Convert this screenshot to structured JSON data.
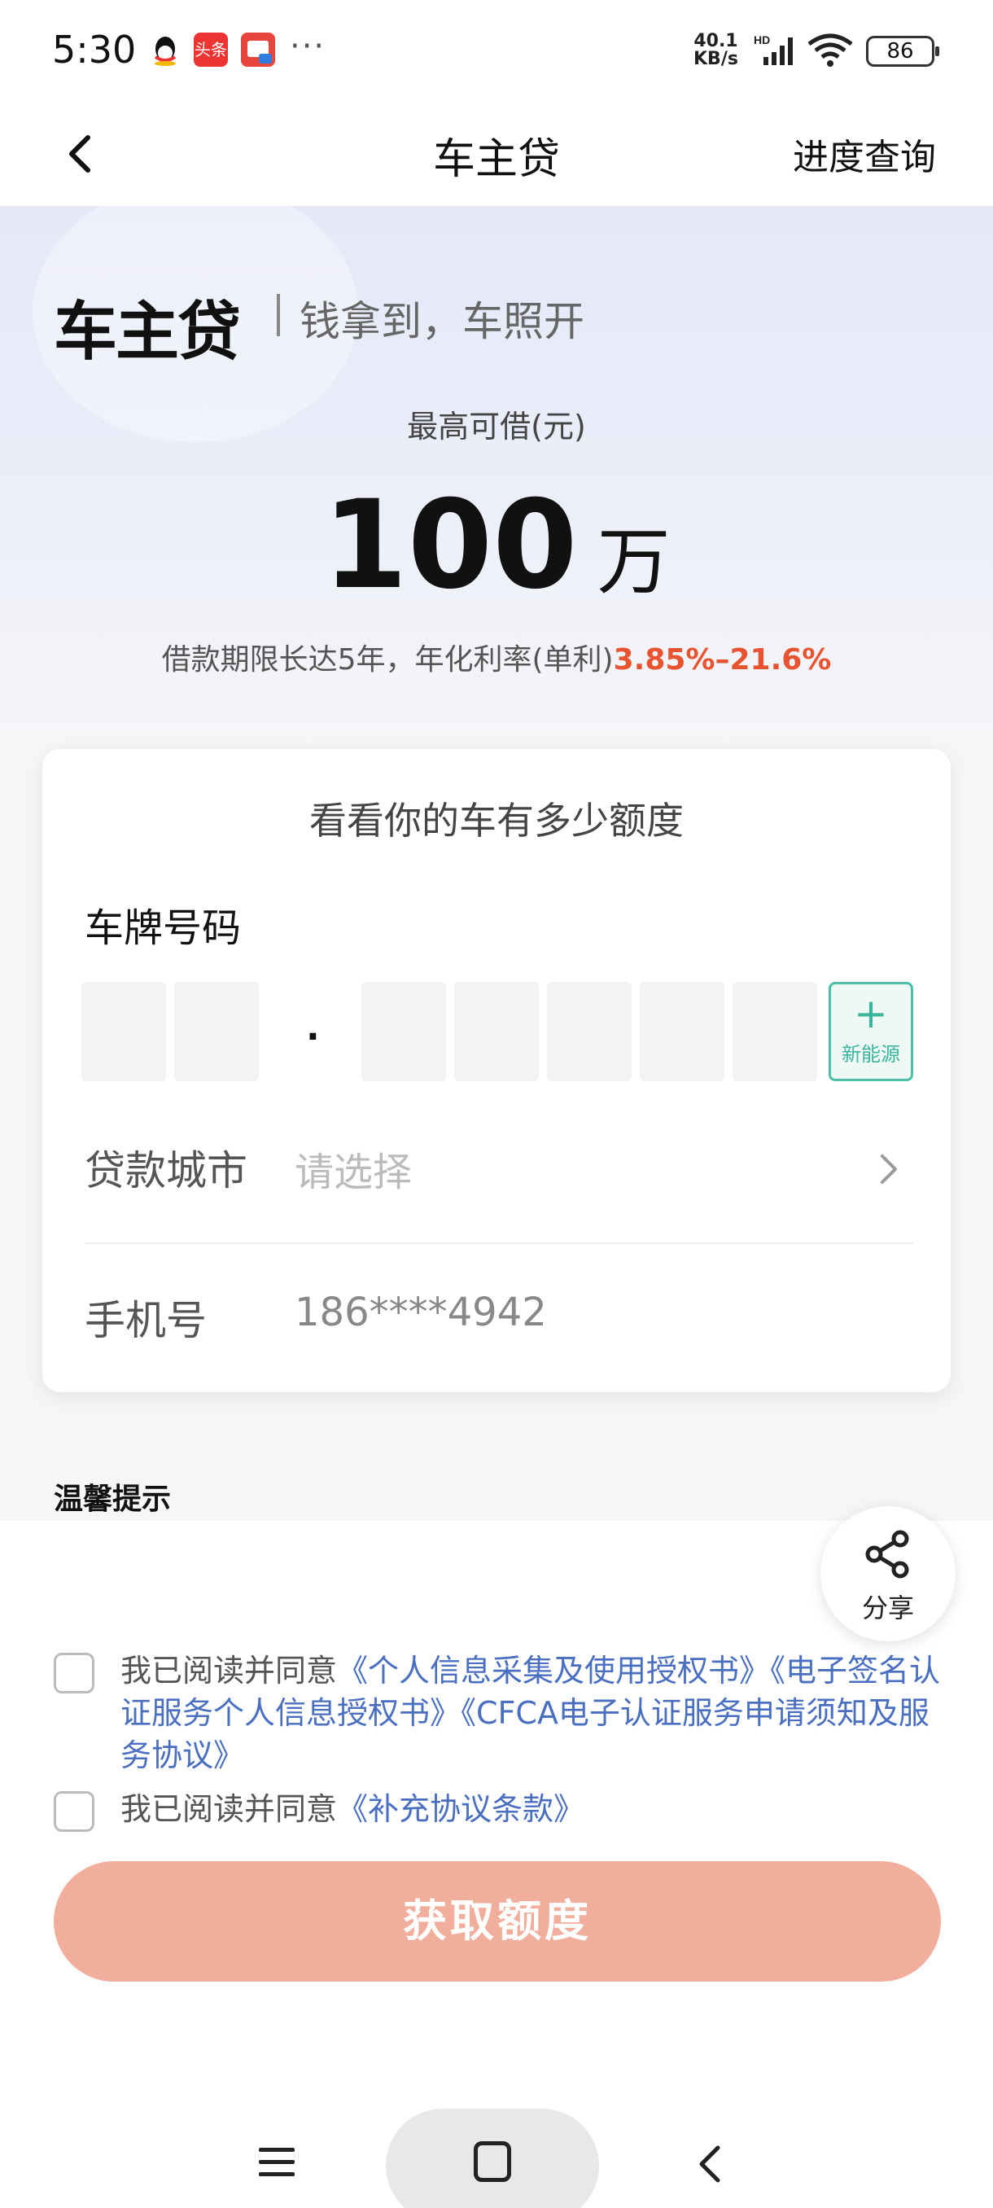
{
  "status_bar": {
    "time": "5:30",
    "app_icons": [
      "qq-icon",
      "toutiao-icon",
      "app-red-icon"
    ],
    "toutiao_text": "头条",
    "more": "···",
    "net_speed_value": "40.1",
    "net_speed_unit": "KB/s",
    "hd": "HD",
    "battery": "86"
  },
  "nav": {
    "title": "车主贷",
    "right_label": "进度查询"
  },
  "hero": {
    "brand": "车主贷",
    "slogan": "钱拿到，车照开",
    "max_label": "最高可借(元)",
    "amount": "100",
    "amount_unit": "万",
    "rate_text": "借款期限长达5年，年化利率(单利)",
    "rate_range": "3.85%–21.6%"
  },
  "form": {
    "card_title": "看看你的车有多少额度",
    "plate_label": "车牌号码",
    "plate_separator": "·",
    "new_energy_plus": "+",
    "new_energy_label": "新能源",
    "city_label": "贷款城市",
    "city_placeholder": "请选择",
    "phone_label": "手机号",
    "phone_value": "186****4942"
  },
  "tips": {
    "title": "温馨提示"
  },
  "share": {
    "label": "分享"
  },
  "agreements": {
    "prefix": "我已阅读并同意",
    "doc1": "《个人信息采集及使用授权书》",
    "doc2": "《电子签名认证服务个人信息授权书》",
    "doc3": "《CFCA电子认证服务申请须知及服务协议》",
    "doc4": "《补充协议条款》"
  },
  "submit_label": "获取额度",
  "colors": {
    "accent_orange": "#e8542f",
    "link_blue": "#4a6fc0",
    "new_energy_green": "#3bb59c",
    "submit_bg": "#f1ae9c"
  }
}
